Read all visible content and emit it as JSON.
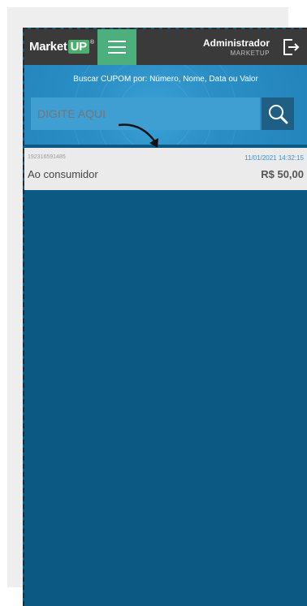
{
  "header": {
    "logo_text": "Market",
    "logo_badge": "UP",
    "logo_mark": "®",
    "user_name": "Administrador",
    "user_company": "MARKETUP"
  },
  "search": {
    "label": "Buscar CUPOM por: Número, Nome, Data ou Valor",
    "placeholder": "DIGITE AQUI"
  },
  "results": [
    {
      "id": "192316591485",
      "date": "11/01/2021 14:32:15",
      "name": "Ao consumidor",
      "value": "R$ 50,00"
    }
  ],
  "icons": {
    "menu": "hamburger-menu-icon",
    "logout": "logout-icon",
    "search": "search-icon",
    "annotation": "curved-arrow-icon"
  },
  "colors": {
    "topbar": "#3a3a3a",
    "menu_button": "#4caf7c",
    "search_band": "#2b8fc6",
    "search_button": "#1f5f86",
    "content_background": "#0c5a84",
    "date_text": "#3a8fd0"
  }
}
